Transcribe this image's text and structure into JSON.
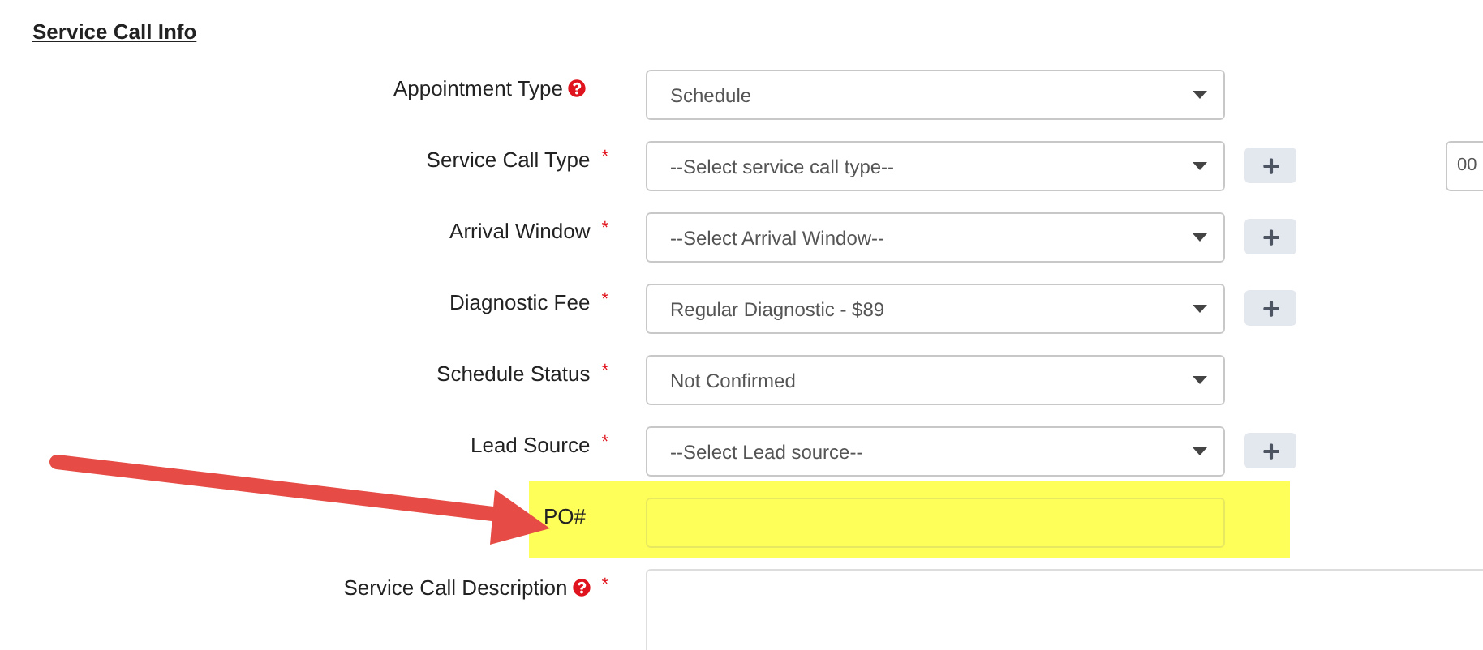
{
  "section_title": "Service Call Info",
  "required_mark": "*",
  "fields": [
    {
      "label": "Appointment Type",
      "kind": "select",
      "value": "Schedule",
      "help": true,
      "required": false,
      "add_button": false,
      "highlighted": false
    },
    {
      "label": "Service Call Type",
      "kind": "select",
      "value": "--Select service call type--",
      "help": false,
      "required": true,
      "add_button": true,
      "highlighted": false,
      "side_field": "00"
    },
    {
      "label": "Arrival Window",
      "kind": "select",
      "value": "--Select Arrival Window--",
      "help": false,
      "required": true,
      "add_button": true,
      "highlighted": false
    },
    {
      "label": "Diagnostic Fee",
      "kind": "select",
      "value": "Regular Diagnostic - $89",
      "help": false,
      "required": true,
      "add_button": true,
      "highlighted": false
    },
    {
      "label": "Schedule Status",
      "kind": "select",
      "value": "Not Confirmed",
      "help": false,
      "required": true,
      "add_button": false,
      "highlighted": false
    },
    {
      "label": "Lead Source",
      "kind": "select",
      "value": "--Select Lead source--",
      "help": false,
      "required": true,
      "add_button": true,
      "highlighted": false
    },
    {
      "label": "PO#",
      "kind": "text",
      "help": false,
      "required": false,
      "add_button": false,
      "highlighted": true
    },
    {
      "label": "Service Call Description",
      "kind": "textarea",
      "help": true,
      "required": true,
      "add_button": false,
      "highlighted": false
    }
  ]
}
